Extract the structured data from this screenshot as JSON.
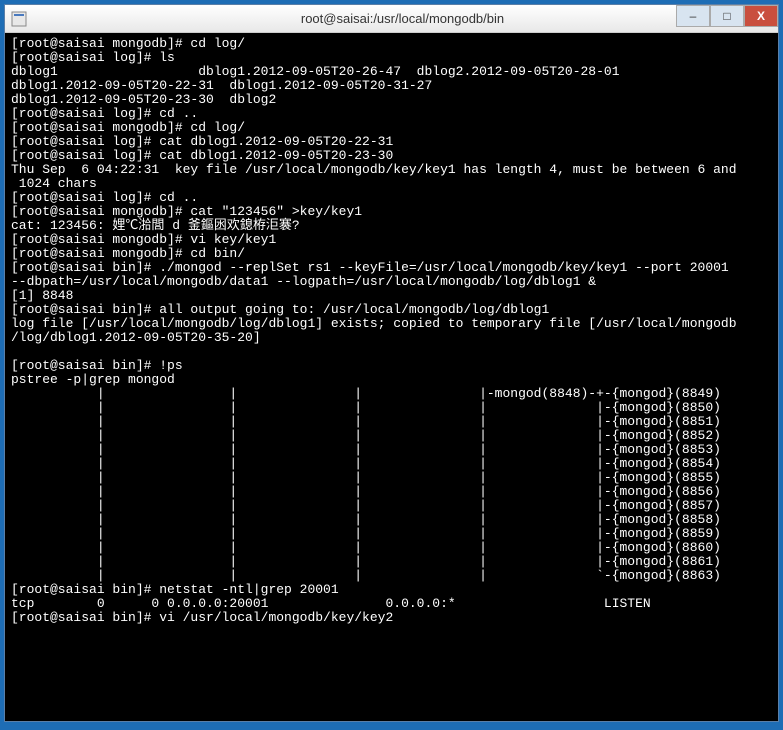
{
  "titlebar": {
    "title": "root@saisai:/usr/local/mongodb/bin"
  },
  "terminal": {
    "lines": [
      "[root@saisai mongodb]# cd log/",
      "[root@saisai log]# ls",
      "dblog1                  dblog1.2012-09-05T20-26-47  dblog2.2012-09-05T20-28-01",
      "dblog1.2012-09-05T20-22-31  dblog1.2012-09-05T20-31-27",
      "dblog1.2012-09-05T20-23-30  dblog2",
      "[root@saisai log]# cd ..",
      "[root@saisai mongodb]# cd log/",
      "[root@saisai log]# cat dblog1.2012-09-05T20-22-31",
      "[root@saisai log]# cat dblog1.2012-09-05T20-23-30",
      "Thu Sep  6 04:22:31  key file /usr/local/mongodb/key/key1 has length 4, must be between 6 and",
      " 1024 chars",
      "[root@saisai log]# cd ..",
      "[root@saisai mongodb]# cat \"123456\" >key/key1",
      "cat: 123456: 娌℃湁閭 d 釜鏂囦欢鎴栫洰褰?",
      "[root@saisai mongodb]# vi key/key1",
      "[root@saisai mongodb]# cd bin/",
      "[root@saisai bin]# ./mongod --replSet rs1 --keyFile=/usr/local/mongodb/key/key1 --port 20001 ",
      "--dbpath=/usr/local/mongodb/data1 --logpath=/usr/local/mongodb/log/dblog1 &",
      "[1] 8848",
      "[root@saisai bin]# all output going to: /usr/local/mongodb/log/dblog1",
      "log file [/usr/local/mongodb/log/dblog1] exists; copied to temporary file [/usr/local/mongodb",
      "/log/dblog1.2012-09-05T20-35-20]",
      "",
      "[root@saisai bin]# !ps",
      "pstree -p|grep mongod",
      "           |                |               |               |-mongod(8848)-+-{mongod}(8849)",
      "           |                |               |               |              |-{mongod}(8850)",
      "           |                |               |               |              |-{mongod}(8851)",
      "           |                |               |               |              |-{mongod}(8852)",
      "           |                |               |               |              |-{mongod}(8853)",
      "           |                |               |               |              |-{mongod}(8854)",
      "           |                |               |               |              |-{mongod}(8855)",
      "           |                |               |               |              |-{mongod}(8856)",
      "           |                |               |               |              |-{mongod}(8857)",
      "           |                |               |               |              |-{mongod}(8858)",
      "           |                |               |               |              |-{mongod}(8859)",
      "           |                |               |               |              |-{mongod}(8860)",
      "           |                |               |               |              |-{mongod}(8861)",
      "           |                |               |               |              `-{mongod}(8863)",
      "[root@saisai bin]# netstat -ntl|grep 20001",
      "tcp        0      0 0.0.0.0:20001               0.0.0.0:*                   LISTEN",
      "[root@saisai bin]# vi /usr/local/mongodb/key/key2"
    ]
  },
  "window_controls": {
    "min": "–",
    "max": "□",
    "close": "X"
  }
}
